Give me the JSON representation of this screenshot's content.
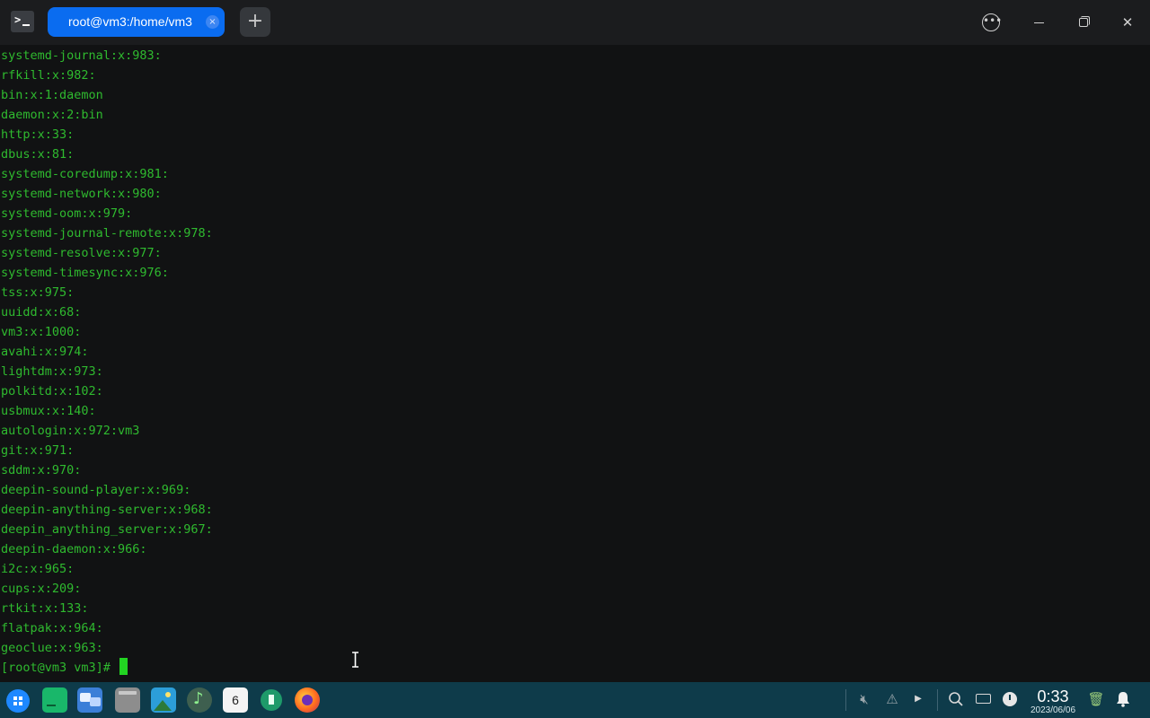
{
  "window": {
    "tab_title": "root@vm3:/home/vm3",
    "tab_close_glyph": "×",
    "new_tab_glyph": "+",
    "menu_glyph": "•••",
    "close_glyph": "✕"
  },
  "terminal": {
    "lines": [
      "systemd-journal:x:983:",
      "rfkill:x:982:",
      "bin:x:1:daemon",
      "daemon:x:2:bin",
      "http:x:33:",
      "dbus:x:81:",
      "systemd-coredump:x:981:",
      "systemd-network:x:980:",
      "systemd-oom:x:979:",
      "systemd-journal-remote:x:978:",
      "systemd-resolve:x:977:",
      "systemd-timesync:x:976:",
      "tss:x:975:",
      "uuidd:x:68:",
      "vm3:x:1000:",
      "avahi:x:974:",
      "lightdm:x:973:",
      "polkitd:x:102:",
      "usbmux:x:140:",
      "autologin:x:972:vm3",
      "git:x:971:",
      "sddm:x:970:",
      "deepin-sound-player:x:969:",
      "deepin-anything-server:x:968:",
      "deepin_anything_server:x:967:",
      "deepin-daemon:x:966:",
      "i2c:x:965:",
      "cups:x:209:",
      "rtkit:x:133:",
      "flatpak:x:964:",
      "geoclue:x:963:"
    ],
    "prompt": "[root@vm3 vm3]# ",
    "text_color": "#2fba2f"
  },
  "taskbar": {
    "calendar_day": "6",
    "time": "0:33",
    "date": "2023/06/06",
    "apps": [
      "launcher-icon",
      "terminal-icon",
      "multitask-view-icon",
      "file-manager-icon",
      "image-viewer-icon",
      "music-icon",
      "calendar-icon",
      "app-store-icon",
      "firefox-icon"
    ],
    "tray": [
      "volume-muted-icon",
      "network-icon",
      "tray-expand-icon",
      "search-icon",
      "keyboard-icon",
      "power-icon",
      "trash-icon",
      "notification-bell-icon"
    ]
  },
  "colors": {
    "tab_active": "#0a6cf0",
    "taskbar_bg": "#0e3b4a",
    "terminal_bg": "#111213",
    "cursor": "#22d422"
  }
}
